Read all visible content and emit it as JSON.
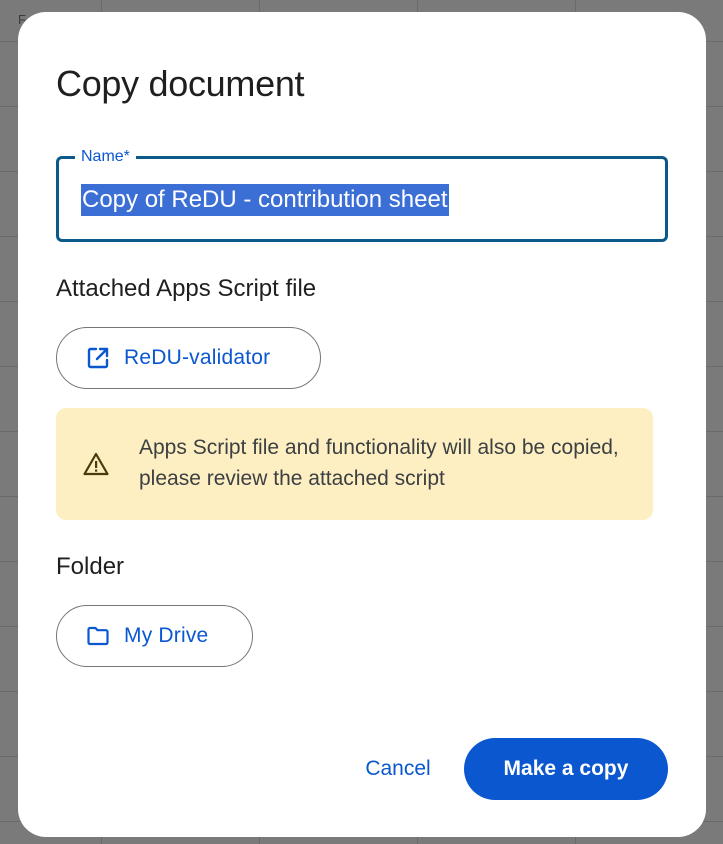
{
  "background": {
    "column_letter": "F"
  },
  "dialog": {
    "title": "Copy document",
    "name_field": {
      "label": "Name*",
      "value": "Copy of ReDU - contribution sheet"
    },
    "apps_script": {
      "section_label": "Attached Apps Script file",
      "file_button_label": "ReDU-validator",
      "file_button_icon": "open-in-new-icon"
    },
    "warning": {
      "icon": "warning-icon",
      "text": "Apps Script file and functionality will also be copied, please review the attached script"
    },
    "folder": {
      "section_label": "Folder",
      "button_label": "My Drive",
      "button_icon": "folder-icon"
    },
    "actions": {
      "cancel_label": "Cancel",
      "confirm_label": "Make a copy"
    }
  },
  "colors": {
    "accent": "#0b57d0",
    "warning_bg": "#feefc3",
    "selection": "#3b6fd6"
  }
}
